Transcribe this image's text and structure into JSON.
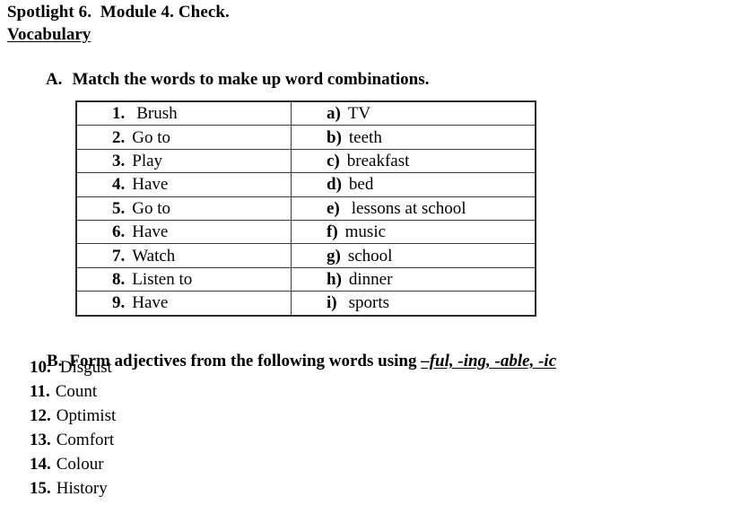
{
  "document": {
    "title": "Spotlight 6.  Module 4. Check.",
    "section_label": "Vocabulary"
  },
  "task_a": {
    "enumerator": "A.",
    "instruction": "Match the words to make up word combinations."
  },
  "match_table": {
    "rows": [
      {
        "left_key": "1.",
        "left_value": "Brush",
        "right_key": "a)",
        "right_value": "TV"
      },
      {
        "left_key": "2.",
        "left_value": "Go to",
        "right_key": "b)",
        "right_value": "teeth"
      },
      {
        "left_key": "3.",
        "left_value": "Play",
        "right_key": "c)",
        "right_value": "breakfast"
      },
      {
        "left_key": "4.",
        "left_value": "Have",
        "right_key": "d)",
        "right_value": "bed"
      },
      {
        "left_key": "5.",
        "left_value": "Go to",
        "right_key": "e)",
        "right_value": "lessons at school"
      },
      {
        "left_key": "6.",
        "left_value": "Have",
        "right_key": "f)",
        "right_value": "music"
      },
      {
        "left_key": "7.",
        "left_value": "Watch",
        "right_key": "g)",
        "right_value": "school"
      },
      {
        "left_key": "8.",
        "left_value": "Listen to",
        "right_key": "h)",
        "right_value": "dinner"
      },
      {
        "left_key": "9.",
        "left_value": "Have",
        "right_key": "i)",
        "right_value": "sports"
      }
    ]
  },
  "task_b": {
    "enumerator": "B.",
    "instruction": "Form adjectives from the following words using ",
    "suffixes": "–ful, -ing, -able, -ic",
    "items": [
      {
        "num": "10.",
        "word": "Disgust"
      },
      {
        "num": "11.",
        "word": "Count"
      },
      {
        "num": "12.",
        "word": "Optimist"
      },
      {
        "num": "13.",
        "word": "Comfort"
      },
      {
        "num": "14.",
        "word": "Colour"
      },
      {
        "num": "15.",
        "word": "History"
      }
    ]
  }
}
